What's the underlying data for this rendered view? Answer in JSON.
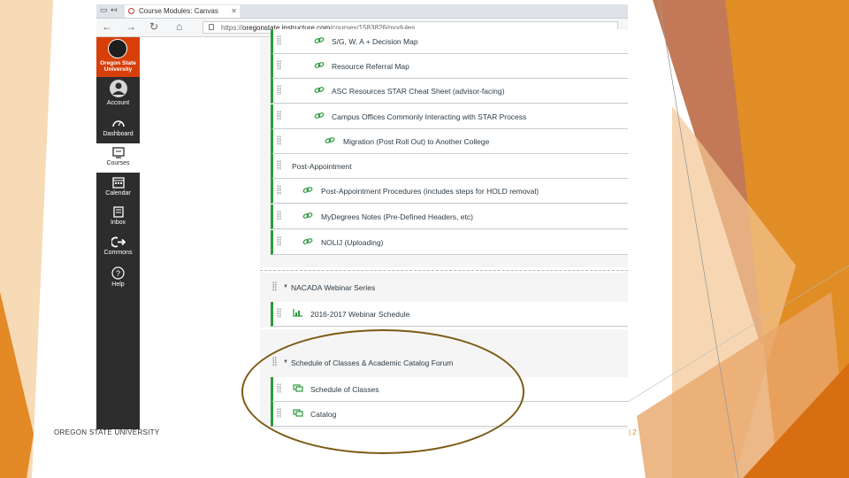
{
  "browser": {
    "tab_title": "Course Modules: Canvas",
    "url_prefix": "https://",
    "url_host": "oregonstate.instructure.com",
    "url_path": "/courses/1583826/modules"
  },
  "sidebar": {
    "logo_text": "Oregon State University",
    "items": [
      {
        "label": "Account"
      },
      {
        "label": "Dashboard"
      },
      {
        "label": "Courses"
      },
      {
        "label": "Calendar"
      },
      {
        "label": "Inbox"
      },
      {
        "label": "Commons"
      },
      {
        "label": "Help"
      }
    ]
  },
  "modules": {
    "top_items": [
      {
        "title": "S/G, W, A + Decision Map"
      },
      {
        "title": "Resource Referral Map"
      },
      {
        "title": "ASC Resources STAR Cheat Sheet (advisor-facing)"
      },
      {
        "title": "Campus Offices Commonly Interacting with STAR Process"
      },
      {
        "title": "Migration (Post Roll Out) to Another College"
      }
    ],
    "post_header": "Post-Appointment",
    "post_items": [
      {
        "title": "Post-Appointment Procedures (includes steps for HOLD removal)"
      },
      {
        "title": "MyDegrees Notes (Pre-Defined Headers, etc)"
      },
      {
        "title": "NOLIJ (Uploading)"
      }
    ],
    "nacada": {
      "title": "NACADA Webinar Series",
      "items": [
        {
          "title": "2016-2017 Webinar Schedule"
        }
      ]
    },
    "schedule": {
      "title": "Schedule of Classes & Academic Catalog Forum",
      "items": [
        {
          "title": "Schedule of Classes"
        },
        {
          "title": "Catalog"
        }
      ]
    }
  },
  "footer": {
    "left": "OREGON STATE UNIVERSITY",
    "right": "| 2"
  },
  "colors": {
    "accent_orange": "#e08a1e",
    "osu_orange": "#d73f09",
    "module_green": "#2b9a3e"
  }
}
